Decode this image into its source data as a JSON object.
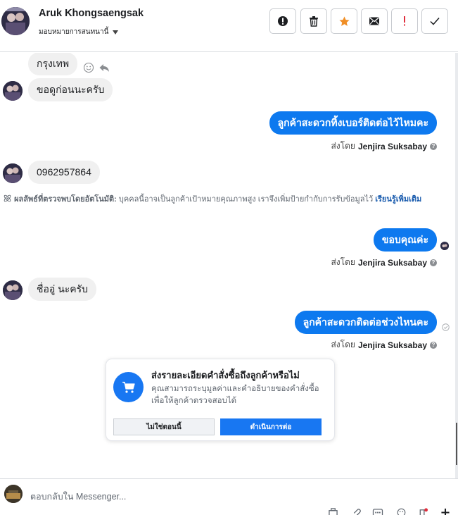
{
  "header": {
    "contact_name": "Aruk Khongsaengsak",
    "assign_label": "มอบหมายการสนทนานี้",
    "buttons": [
      {
        "name": "report-button",
        "icon": "exclamation-circle-icon"
      },
      {
        "name": "delete-button",
        "icon": "trash-icon"
      },
      {
        "name": "star-button",
        "icon": "star-icon",
        "color": "#f08e25"
      },
      {
        "name": "mark-unread-button",
        "icon": "envelope-icon"
      },
      {
        "name": "spam-button",
        "icon": "exclamation-icon",
        "color": "#e02d3c"
      },
      {
        "name": "done-button",
        "icon": "check-icon"
      }
    ]
  },
  "messages": {
    "m1": "กรุงเทพ",
    "m2": "ขอดูก่อนนะครับ",
    "m3": "ลูกค้าสะดวกทิ้งเบอร์ติดต่อไว้ไหมคะ",
    "m3_sent_prefix": "ส่งโดย",
    "m3_sent_by": "Jenjira Suksabay",
    "m4": "0962957864",
    "auto_detect_lead": "ผลลัพธ์ที่ตรวจพบโดยอัตโนมัติ:",
    "auto_detect_text": "บุคคลนี้อาจเป็นลูกค้าเป้าหมายคุณภาพสูง เราจึงเพิ่มป้ายกำกับการรับข้อมูลไว้",
    "auto_detect_link": "เรียนรู้เพิ่มเติม",
    "m5": "ขอบคุณค่ะ",
    "m5_sent_prefix": "ส่งโดย",
    "m5_sent_by": "Jenjira Suksabay",
    "m6": "ชื่ออู่ นะครับ",
    "m7": "ลูกค้าสะดวกติดต่อช่วงไหนคะ",
    "m7_sent_prefix": "ส่งโดย",
    "m7_sent_by": "Jenjira Suksabay"
  },
  "order_card": {
    "title": "ส่งรายละเอียดคำสั่งซื้อถึงลูกค้าหรือไม่",
    "description": "คุณสามารถระบุมูลค่าและคำอธิบายของคำสั่งซื้อเพื่อให้ลูกค้าตรวจสอบได้",
    "secondary_button": "ไม่ใช่ตอนนี้",
    "primary_button": "ดำเนินการต่อ",
    "icon": "shopping-cart-icon"
  },
  "composer": {
    "placeholder": "ตอบกลับใน Messenger..."
  },
  "colors": {
    "accent": "#0d79ef",
    "incoming_bubble": "#f0f0f0",
    "brand_blue": "#1877f2"
  }
}
